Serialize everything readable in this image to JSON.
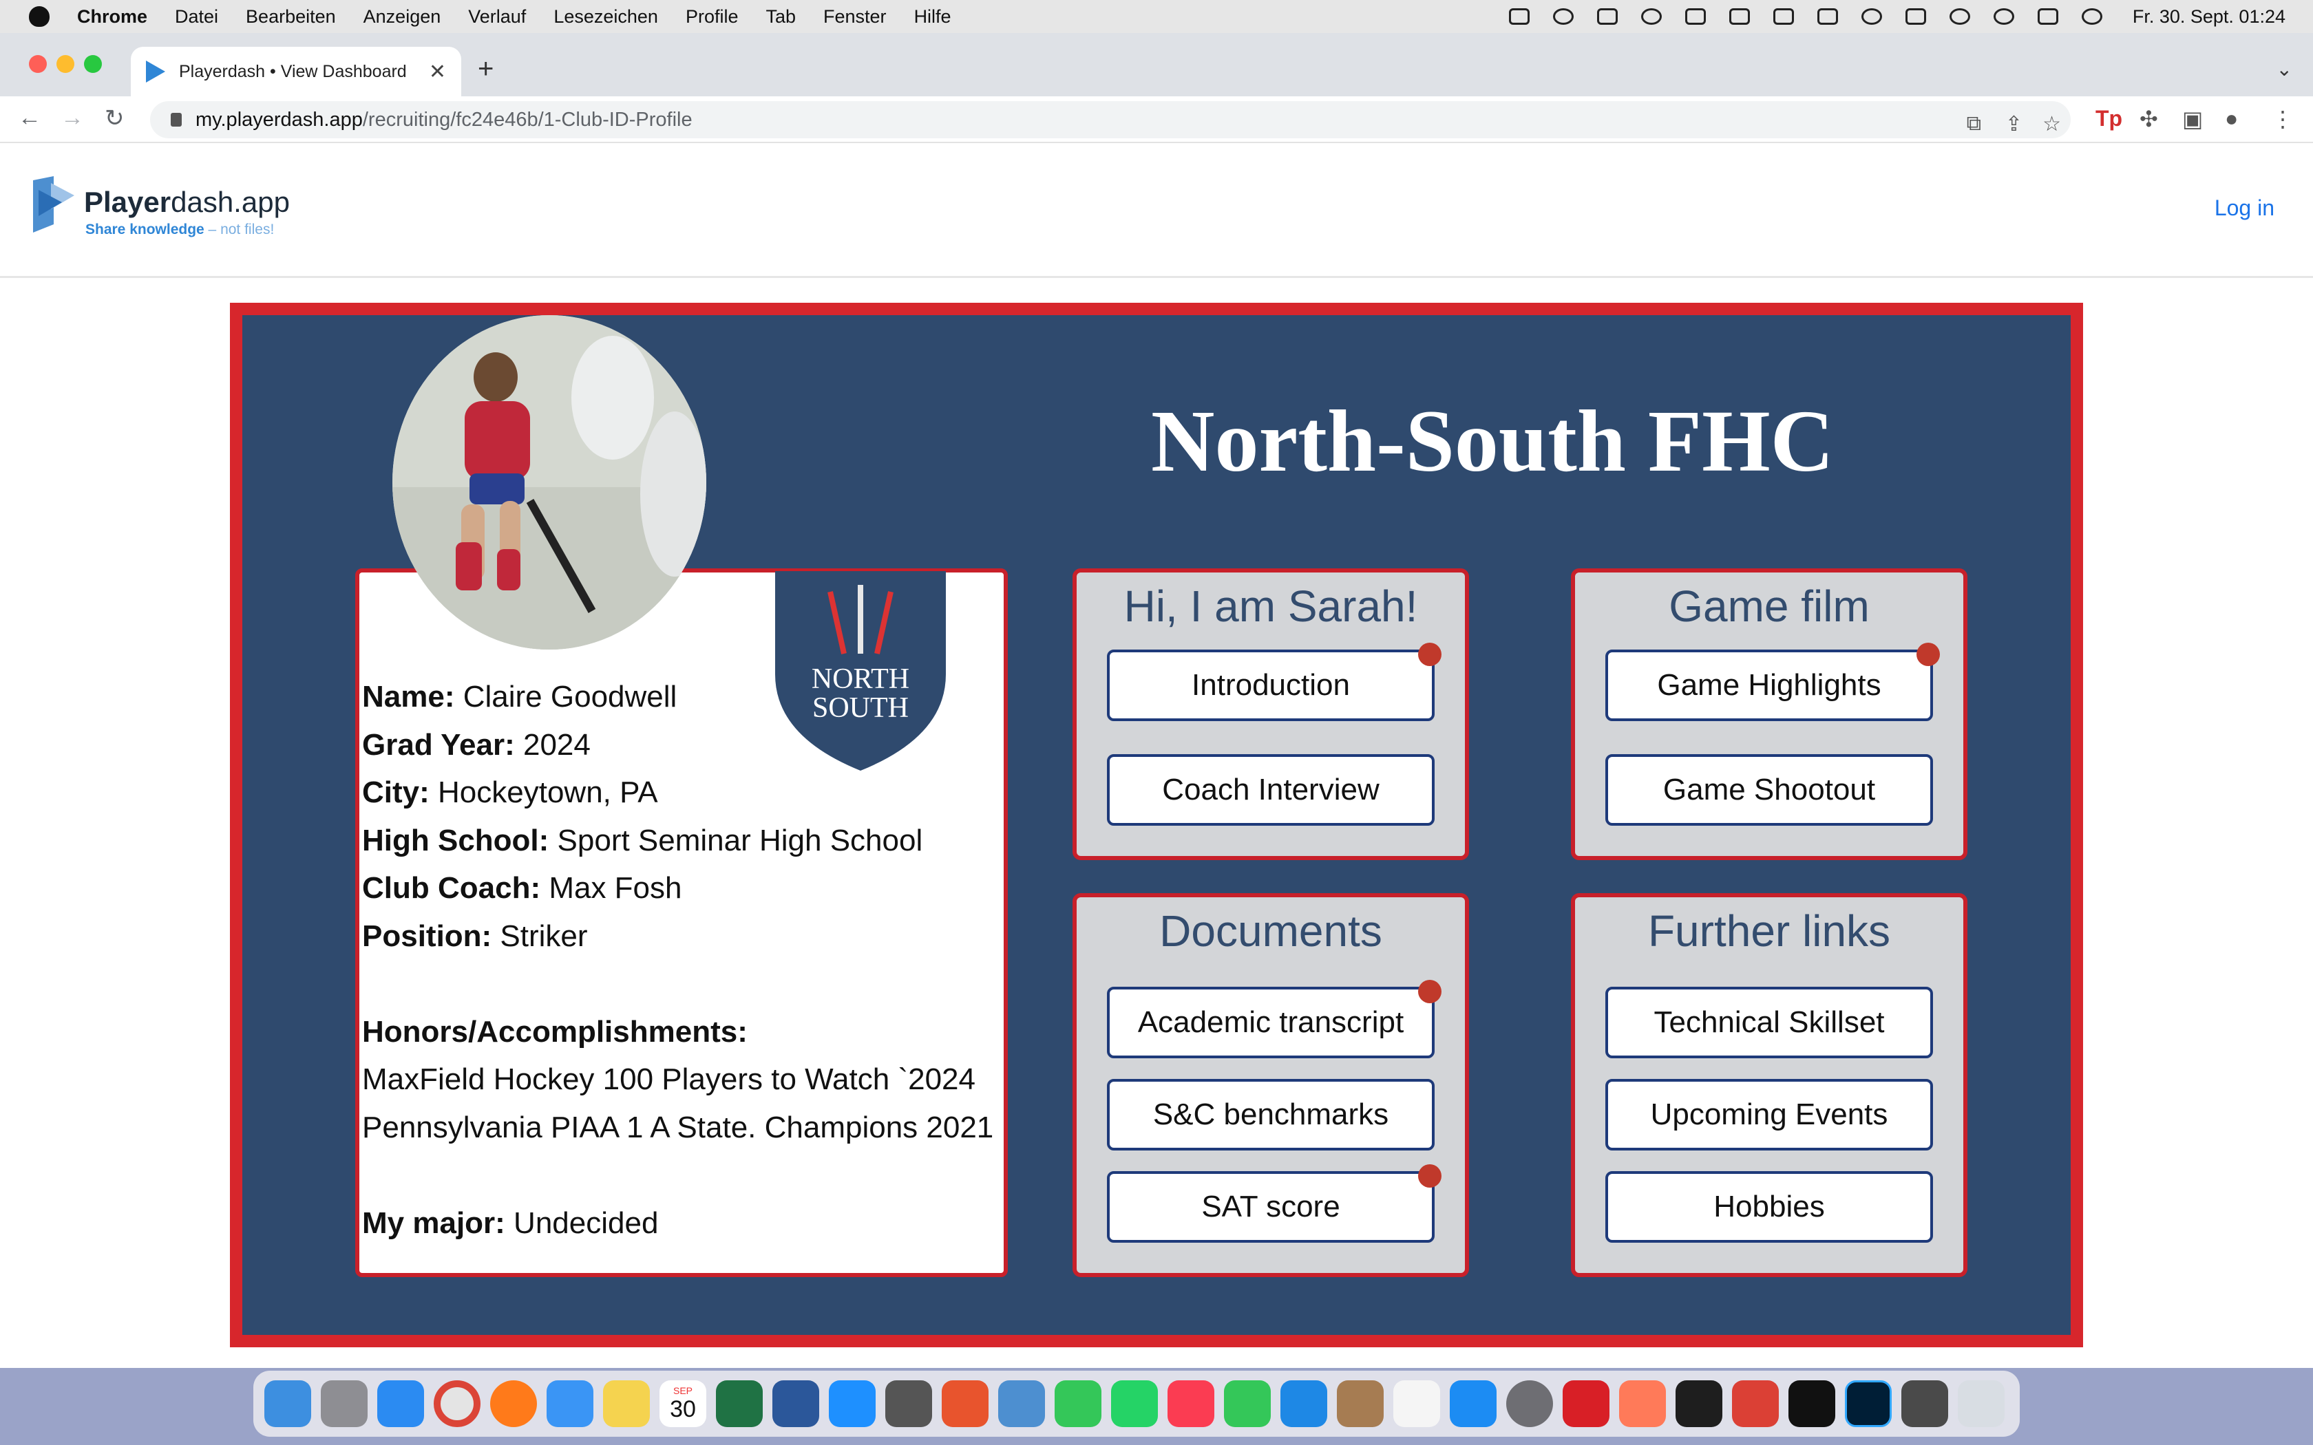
{
  "menubar": {
    "app": "Chrome",
    "items": [
      "Datei",
      "Bearbeiten",
      "Anzeigen",
      "Verlauf",
      "Lesezeichen",
      "Profile",
      "Tab",
      "Fenster",
      "Hilfe"
    ],
    "clock": "Fr. 30. Sept. 01:24"
  },
  "browser": {
    "tab_title": "Playerdash • View Dashboard",
    "url_host": "my.playerdash.app",
    "url_path": "/recruiting/fc24e46b/1-Club-ID-Profile"
  },
  "site": {
    "logo_name_bold": "Player",
    "logo_name_rest": "dash.app",
    "tagline_main": "Share knowledge",
    "tagline_sub": " – not files!",
    "login": "Log in"
  },
  "profile": {
    "club_title": "North-South FHC",
    "crest_line1": "NORTH",
    "crest_line2": "SOUTH",
    "fields": [
      {
        "label": "Name:",
        "value": " Claire Goodwell"
      },
      {
        "label": "Grad Year:",
        "value": " 2024"
      },
      {
        "label": "City:",
        "value": " Hockeytown, PA"
      },
      {
        "label": "High School:",
        "value": " Sport Seminar High School"
      },
      {
        "label": "Club Coach:",
        "value": " Max Fosh"
      },
      {
        "label": "Position:",
        "value": " Striker"
      }
    ],
    "honors_label": "Honors/Accomplishments:",
    "honors_text": "MaxField Hockey 100 Players to Watch `2024 Pennsylvania PIAA 1 A State. Champions 2021",
    "major_label": "My major:",
    "major_value": " Undecided"
  },
  "panels": {
    "intro": {
      "title": "Hi, I am Sarah!",
      "buttons": [
        "Introduction",
        "Coach Interview"
      ]
    },
    "film": {
      "title": "Game film",
      "buttons": [
        "Game Highlights",
        "Game Shootout"
      ]
    },
    "docs": {
      "title": "Documents",
      "buttons": [
        "Academic transcript",
        "S&C benchmarks",
        "SAT score"
      ]
    },
    "links": {
      "title": "Further links",
      "buttons": [
        "Technical Skillset",
        "Upcoming Events",
        "Hobbies"
      ]
    }
  },
  "colors": {
    "card_bg": "#2f4a6e",
    "card_border": "#d7262c",
    "panel_title": "#334c6e",
    "notify_dot": "#c0392b",
    "link": "#1a73e8"
  },
  "dock": {
    "calendar_day": "30",
    "calendar_month": "SEP"
  }
}
